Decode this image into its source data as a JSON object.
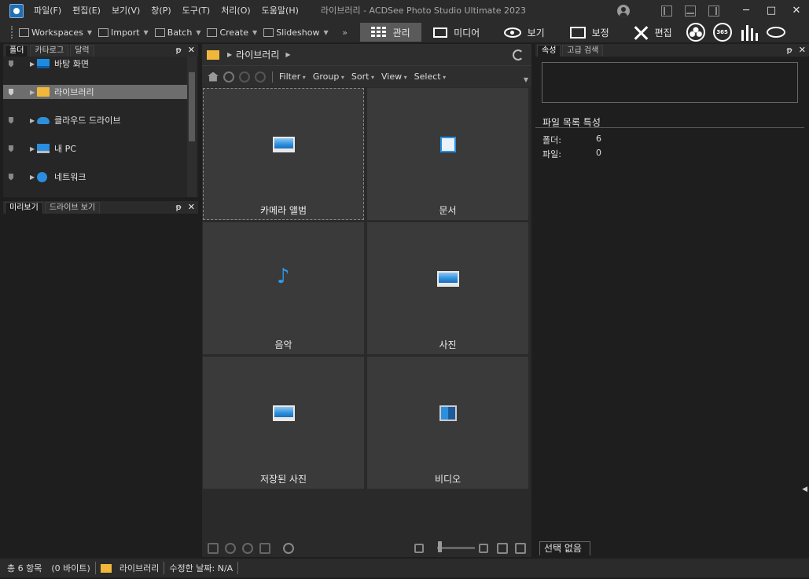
{
  "app": {
    "title": "라이브러리 - ACDSee Photo Studio Ultimate 2023",
    "menu": [
      "파일(F)",
      "편집(E)",
      "보기(V)",
      "창(P)",
      "도구(T)",
      "처리(O)",
      "도움말(H)"
    ],
    "window_controls": {
      "minimize": "─",
      "maximize": "□",
      "close": "✕"
    }
  },
  "toolbar": {
    "items": [
      {
        "label": "Workspaces",
        "icon": "workspaces-icon"
      },
      {
        "label": "Import",
        "icon": "import-icon"
      },
      {
        "label": "Batch",
        "icon": "batch-icon"
      },
      {
        "label": "Create",
        "icon": "create-icon"
      },
      {
        "label": "Slideshow",
        "icon": "slideshow-icon"
      }
    ],
    "more": "»",
    "modes": [
      {
        "label": "관리",
        "icon": "grid-icon",
        "active": true
      },
      {
        "label": "미디어",
        "icon": "media-icon",
        "active": false
      },
      {
        "label": "보기",
        "icon": "eye-icon",
        "active": false
      },
      {
        "label": "보정",
        "icon": "develop-icon",
        "active": false
      },
      {
        "label": "편집",
        "icon": "edit-tools-icon",
        "active": false
      }
    ],
    "extra_icons": [
      "people-icon",
      "365-icon",
      "dashboard-icon",
      "privacy-eye-icon"
    ],
    "badge_365": "365"
  },
  "folders_panel": {
    "tabs": [
      "폴더",
      "카타로그",
      "달력"
    ],
    "active_tab": "폴더",
    "items": [
      {
        "label": "바탕 화면",
        "icon": "desktop-icon"
      },
      {
        "label": "라이브러리",
        "icon": "library-folder-icon",
        "selected": true
      },
      {
        "label": "클라우드 드라이브",
        "icon": "cloud-icon"
      },
      {
        "label": "내 PC",
        "icon": "pc-icon"
      },
      {
        "label": "네트워크",
        "icon": "network-icon"
      }
    ]
  },
  "preview_panel": {
    "tabs": [
      "미리보기",
      "드라이브 보기"
    ],
    "active_tab": "미리보기"
  },
  "panel_controls": {
    "pin": "ᵽ",
    "close": "✕"
  },
  "browser": {
    "path": "라이브러리",
    "filterbar": [
      "Filter",
      "Group",
      "Sort",
      "View",
      "Select"
    ],
    "items": [
      {
        "label": "카메라 앨범",
        "icon": "camera-album-icon"
      },
      {
        "label": "문서",
        "icon": "documents-icon"
      },
      {
        "label": "음악",
        "icon": "music-icon"
      },
      {
        "label": "사진",
        "icon": "pictures-icon"
      },
      {
        "label": "저장된 사진",
        "icon": "saved-pictures-icon"
      },
      {
        "label": "비디오",
        "icon": "videos-icon"
      }
    ]
  },
  "properties": {
    "tabs": [
      "속성",
      "고급 검색"
    ],
    "active_tab": "속성",
    "section_title": "파일 목록 특성",
    "rows": [
      {
        "label": "폴더:",
        "value": "6"
      },
      {
        "label": "파일:",
        "value": "0"
      }
    ],
    "footer_tab": "선택 없음"
  },
  "status": {
    "total": "총 6 항목",
    "size": "(0 바이트)",
    "location": "라이브러리",
    "modified": "수정한 날짜: N/A"
  },
  "colors": {
    "background": "#1e1e1e",
    "active_mode": "#5a5a5a",
    "folder": "#f0b73b",
    "accent": "#2b8fe0"
  }
}
